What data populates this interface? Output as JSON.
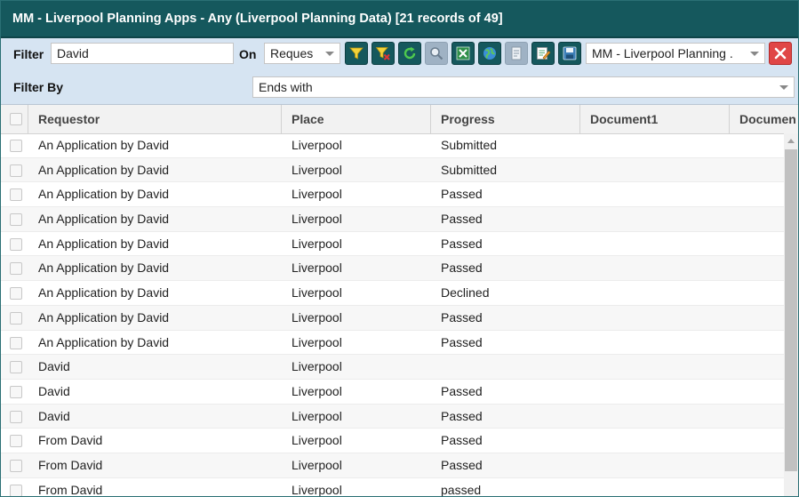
{
  "window": {
    "title": "MM - Liverpool Planning Apps - Any (Liverpool Planning Data) [21 records of 49]"
  },
  "filter": {
    "label": "Filter",
    "value": "David",
    "on_label": "On",
    "on_value": "Reques",
    "view_value": "MM - Liverpool Planning ."
  },
  "filter_by": {
    "label": "Filter By",
    "value": "Ends with"
  },
  "toolbar_icons": [
    "filter-icon",
    "clear-filter-icon",
    "refresh-icon",
    "search-icon",
    "excel-icon",
    "globe-icon",
    "document-icon",
    "edit-icon",
    "save-icon",
    "close-icon"
  ],
  "grid": {
    "columns": [
      "Requestor",
      "Place",
      "Progress",
      "Document1",
      "Documen"
    ],
    "rows": [
      {
        "requestor": "An Application by David",
        "place": "Liverpool",
        "progress": "Submitted",
        "document1": "",
        "document2": ""
      },
      {
        "requestor": "An Application by David",
        "place": "Liverpool",
        "progress": "Submitted",
        "document1": "",
        "document2": ""
      },
      {
        "requestor": "An Application by David",
        "place": "Liverpool",
        "progress": "Passed",
        "document1": "",
        "document2": ""
      },
      {
        "requestor": "An Application by David",
        "place": "Liverpool",
        "progress": "Passed",
        "document1": "",
        "document2": ""
      },
      {
        "requestor": "An Application by David",
        "place": "Liverpool",
        "progress": "Passed",
        "document1": "",
        "document2": ""
      },
      {
        "requestor": "An Application by David",
        "place": "Liverpool",
        "progress": "Passed",
        "document1": "",
        "document2": ""
      },
      {
        "requestor": "An Application by David",
        "place": "Liverpool",
        "progress": "Declined",
        "document1": "",
        "document2": ""
      },
      {
        "requestor": "An Application by David",
        "place": "Liverpool",
        "progress": "Passed",
        "document1": "",
        "document2": ""
      },
      {
        "requestor": "An Application by David",
        "place": "Liverpool",
        "progress": "Passed",
        "document1": "",
        "document2": ""
      },
      {
        "requestor": "David",
        "place": "Liverpool",
        "progress": "",
        "document1": "",
        "document2": ""
      },
      {
        "requestor": "David",
        "place": "Liverpool",
        "progress": "Passed",
        "document1": "",
        "document2": ""
      },
      {
        "requestor": "David",
        "place": "Liverpool",
        "progress": "Passed",
        "document1": "",
        "document2": ""
      },
      {
        "requestor": "From David",
        "place": "Liverpool",
        "progress": "Passed",
        "document1": "",
        "document2": ""
      },
      {
        "requestor": "From David",
        "place": "Liverpool",
        "progress": "Passed",
        "document1": "",
        "document2": ""
      },
      {
        "requestor": "From David",
        "place": "Liverpool",
        "progress": "passed",
        "document1": "",
        "document2": ""
      }
    ]
  },
  "colors": {
    "title_bg": "#15585d",
    "toolbar_bg": "#d6e4f2",
    "button_dark": "#15585d",
    "close_red": "#e04646"
  }
}
